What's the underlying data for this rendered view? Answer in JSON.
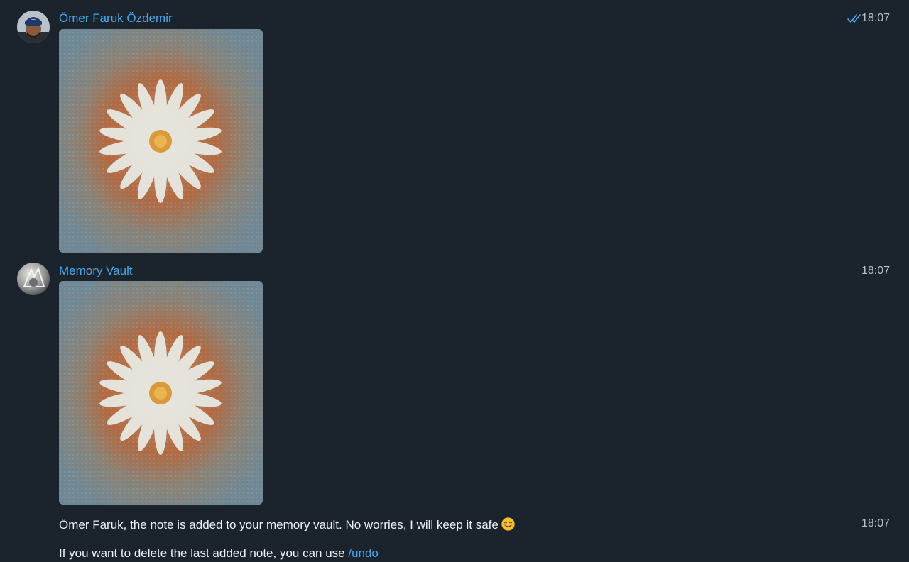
{
  "messages": [
    {
      "sender": "Ömer Faruk Özdemir",
      "time": "18:07",
      "read_status": "double-check-icon",
      "attachment": "photo"
    },
    {
      "sender": "Memory Vault",
      "time": "18:07",
      "attachment": "photo"
    },
    {
      "time": "18:07",
      "text": "Ömer Faruk, the note is added to your memory vault. No worries, I will keep it safe",
      "emoji": "😊",
      "followup_text": "If you want to delete the last added note, you can use ",
      "command": "/undo"
    }
  ],
  "colors": {
    "background": "#1b232d",
    "sender_name": "#4aa7ee",
    "link": "#4aa7ee",
    "timestamp": "#b7c1cc",
    "message_text": "#eef2f6"
  }
}
